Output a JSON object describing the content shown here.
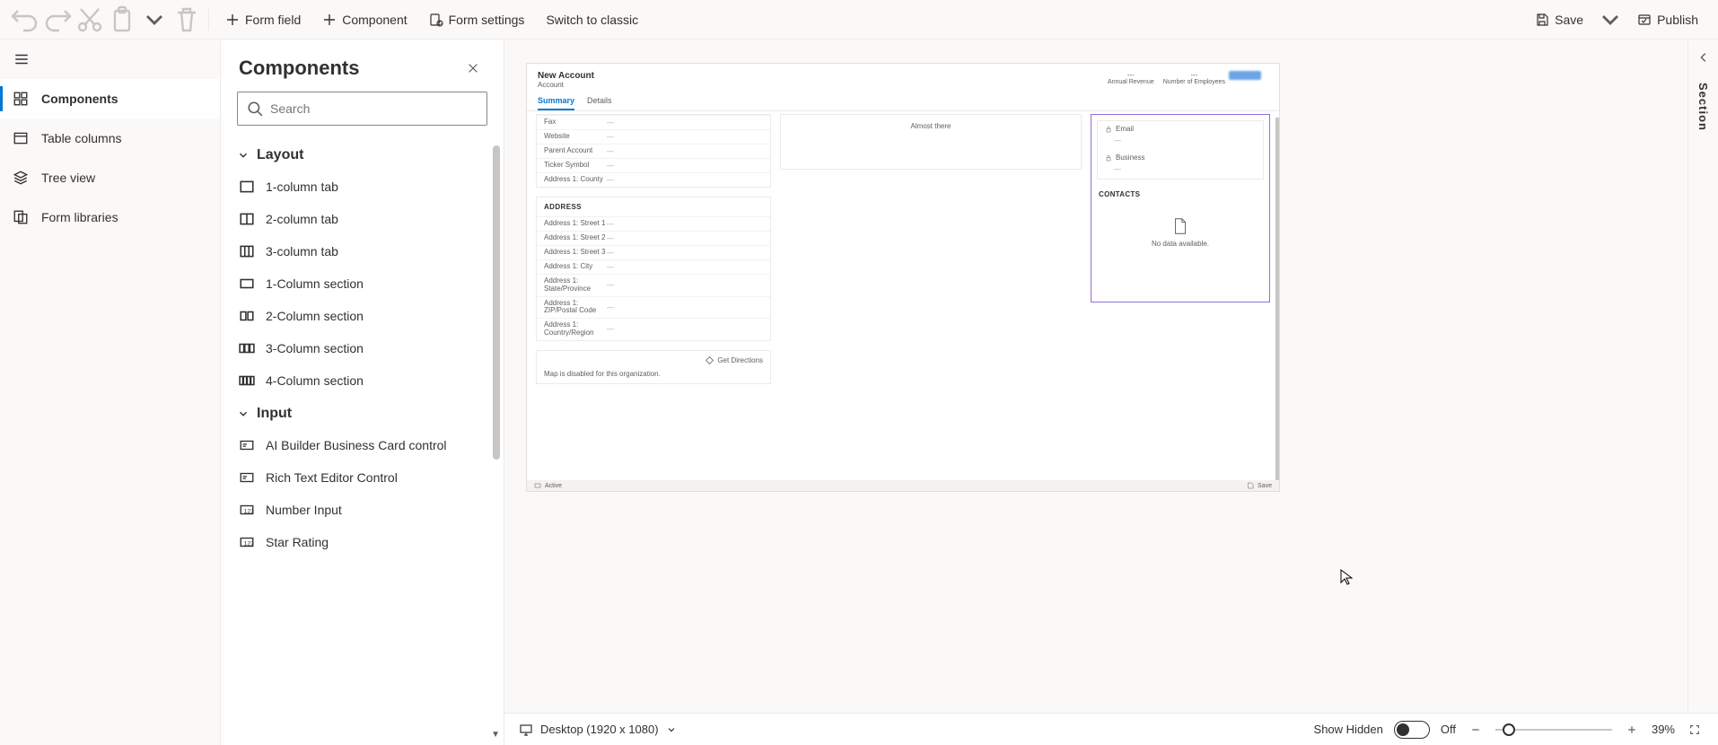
{
  "toolbar": {
    "form_field": "Form field",
    "component": "Component",
    "form_settings": "Form settings",
    "switch_classic": "Switch to classic",
    "save": "Save",
    "publish": "Publish"
  },
  "nav": {
    "items": [
      {
        "label": "Components"
      },
      {
        "label": "Table columns"
      },
      {
        "label": "Tree view"
      },
      {
        "label": "Form libraries"
      }
    ]
  },
  "panel": {
    "title": "Components",
    "search_placeholder": "Search",
    "groups": {
      "layout": {
        "label": "Layout",
        "items": [
          "1-column tab",
          "2-column tab",
          "3-column tab",
          "1-Column section",
          "2-Column section",
          "3-Column section",
          "4-Column section"
        ]
      },
      "input": {
        "label": "Input",
        "items": [
          "AI Builder Business Card control",
          "Rich Text Editor Control",
          "Number Input",
          "Star Rating"
        ]
      }
    }
  },
  "form": {
    "title": "New Account",
    "subtitle": "Account",
    "header_fields": [
      {
        "value": "---",
        "label": "Annual Revenue"
      },
      {
        "value": "---",
        "label": "Number of Employees"
      }
    ],
    "tabs": [
      "Summary",
      "Details"
    ],
    "col1_top": [
      {
        "l": "Fax",
        "v": "---"
      },
      {
        "l": "Website",
        "v": "---"
      },
      {
        "l": "Parent Account",
        "v": "---"
      },
      {
        "l": "Ticker Symbol",
        "v": "---"
      },
      {
        "l": "Address 1: County",
        "v": "---"
      }
    ],
    "address_hdr": "ADDRESS",
    "address_fields": [
      {
        "l": "Address 1: Street 1",
        "v": "---"
      },
      {
        "l": "Address 1: Street 2",
        "v": "---"
      },
      {
        "l": "Address 1: Street 3",
        "v": "---"
      },
      {
        "l": "Address 1: City",
        "v": "---"
      },
      {
        "l": "Address 1: State/Province",
        "v": "---"
      },
      {
        "l": "Address 1: ZIP/Postal Code",
        "v": "---"
      },
      {
        "l": "Address 1: Country/Region",
        "v": "---"
      }
    ],
    "map_directions": "Get Directions",
    "map_disabled": "Map is disabled for this organization.",
    "col2_text": "Almost there",
    "col3": {
      "email": "Email",
      "business": "Business",
      "contacts_hdr": "CONTACTS",
      "empty": "No data available."
    },
    "status_left": "Active",
    "status_right": "Save"
  },
  "right_pane": {
    "label": "Section"
  },
  "bottom": {
    "viewport": "Desktop (1920 x 1080)",
    "show_hidden": "Show Hidden",
    "toggle_state": "Off",
    "zoom": "39%"
  }
}
